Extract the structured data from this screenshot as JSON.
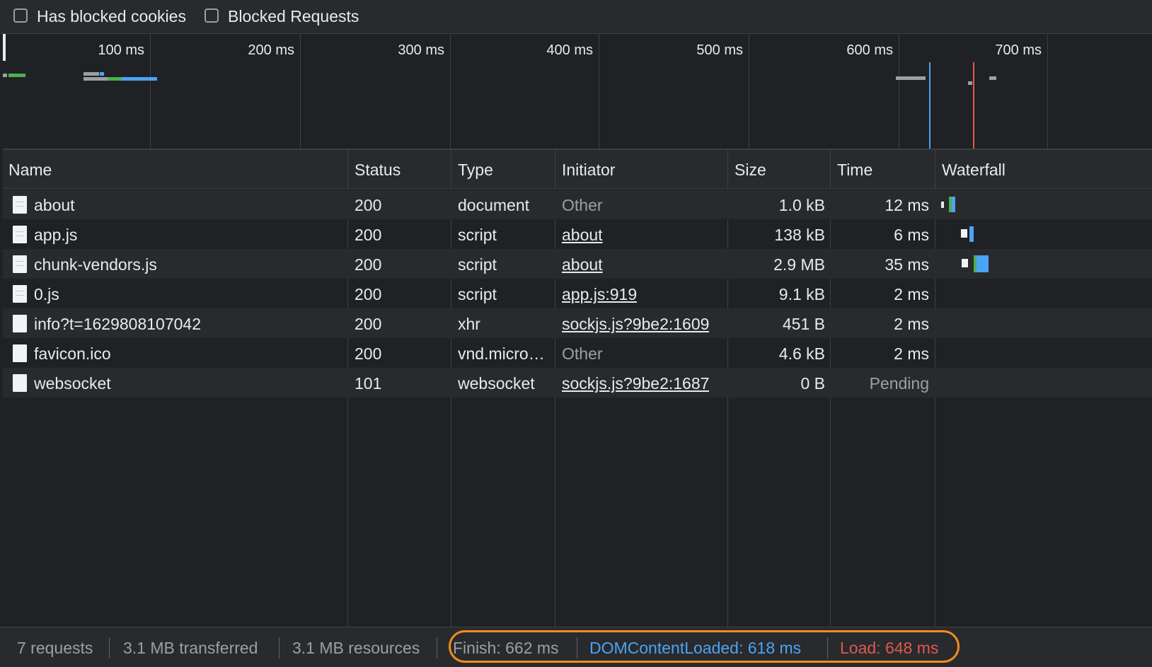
{
  "filters": {
    "has_blocked_cookies": {
      "label": "Has blocked cookies",
      "checked": false
    },
    "blocked_requests": {
      "label": "Blocked Requests",
      "checked": false
    }
  },
  "overview": {
    "tick_labels": [
      "100 ms",
      "200 ms",
      "300 ms",
      "400 ms",
      "500 ms",
      "600 ms",
      "700 ms"
    ],
    "dom_content_loaded_color": "#4aa4f4",
    "load_color": "#e0584d"
  },
  "table": {
    "columns": [
      "Name",
      "Status",
      "Type",
      "Initiator",
      "Size",
      "Time",
      "Waterfall"
    ],
    "rows": [
      {
        "name": "about",
        "status": "200",
        "type": "document",
        "initiator": "Other",
        "initiator_link": false,
        "size": "1.0 kB",
        "time": "12 ms",
        "icon": "document-icon"
      },
      {
        "name": "app.js",
        "status": "200",
        "type": "script",
        "initiator": "about",
        "initiator_link": true,
        "size": "138 kB",
        "time": "6 ms",
        "icon": "document-icon"
      },
      {
        "name": "chunk-vendors.js",
        "status": "200",
        "type": "script",
        "initiator": "about",
        "initiator_link": true,
        "size": "2.9 MB",
        "time": "35 ms",
        "icon": "document-icon"
      },
      {
        "name": "0.js",
        "status": "200",
        "type": "script",
        "initiator": "app.js:919",
        "initiator_link": true,
        "size": "9.1 kB",
        "time": "2 ms",
        "icon": "document-icon"
      },
      {
        "name": "info?t=1629808107042",
        "status": "200",
        "type": "xhr",
        "initiator": "sockjs.js?9be2:1609",
        "initiator_link": true,
        "size": "451 B",
        "time": "2 ms",
        "icon": "file-icon"
      },
      {
        "name": "favicon.ico",
        "status": "200",
        "type": "vnd.micro…",
        "initiator": "Other",
        "initiator_link": false,
        "size": "4.6 kB",
        "time": "2 ms",
        "icon": "file-icon"
      },
      {
        "name": "websocket",
        "status": "101",
        "type": "websocket",
        "initiator": "sockjs.js?9be2:1687",
        "initiator_link": true,
        "size": "0 B",
        "time": "Pending",
        "time_muted": true,
        "icon": "file-icon"
      }
    ]
  },
  "summary": {
    "requests": "7 requests",
    "transferred": "3.1 MB transferred",
    "resources": "3.1 MB resources",
    "finish": "Finish: 662 ms",
    "dom_content_loaded": "DOMContentLoaded: 618 ms",
    "load": "Load: 648 ms",
    "highlight_color": "#f28b1f"
  }
}
